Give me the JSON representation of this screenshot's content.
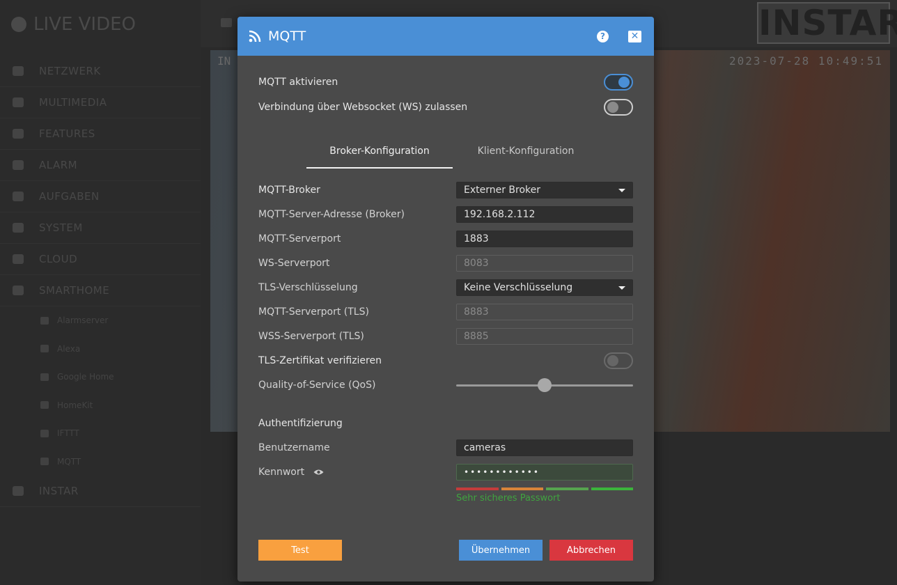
{
  "app": {
    "title": "LIVE VIDEO",
    "nav": [
      "NETZWERK",
      "MULTIMEDIA",
      "FEATURES",
      "ALARM",
      "AUFGABEN",
      "SYSTEM",
      "CLOUD",
      "SMARTHOME"
    ],
    "subnav": [
      "Alarmserver",
      "Alexa",
      "Google Home",
      "HomeKit",
      "IFTTT",
      "MQTT"
    ],
    "nav_last": "INSTAR",
    "logo": "INSTAR",
    "video_timestamp": "2023-07-28 10:49:51",
    "video_corner": "IN"
  },
  "modal": {
    "title": "MQTT",
    "toggles": {
      "mqtt_enable_label": "MQTT aktivieren",
      "mqtt_enable_on": true,
      "ws_label": "Verbindung über Websocket (WS) zulassen",
      "ws_on": false
    },
    "tabs": [
      "Broker-Konfiguration",
      "Klient-Konfiguration"
    ],
    "active_tab": 0,
    "fields": {
      "broker_label": "MQTT-Broker",
      "broker_value": "Externer Broker",
      "server_label": "MQTT-Server-Adresse (Broker)",
      "server_value": "192.168.2.112",
      "port_label": "MQTT-Serverport",
      "port_value": "1883",
      "ws_port_label": "WS-Serverport",
      "ws_port_value": "8083",
      "tls_label": "TLS-Verschlüsselung",
      "tls_value": "Keine Verschlüsselung",
      "port_tls_label": "MQTT-Serverport (TLS)",
      "port_tls_value": "8883",
      "wss_port_label": "WSS-Serverport (TLS)",
      "wss_port_value": "8885",
      "verify_label": "TLS-Zertifikat verifizieren",
      "verify_on": false,
      "qos_label": "Quality-of-Service (QoS)",
      "qos_value": 1,
      "qos_max": 2
    },
    "auth": {
      "section": "Authentifizierung",
      "user_label": "Benutzername",
      "user_value": "cameras",
      "pass_label": "Kennwort",
      "pass_value": "••••••••••••",
      "strength_text": "Sehr sicheres Passwort",
      "strength_colors": [
        "#c43c3c",
        "#d9843a",
        "#56a34f",
        "#3cb43c"
      ]
    },
    "buttons": {
      "test": "Test",
      "apply": "Übernehmen",
      "cancel": "Abbrechen"
    },
    "colors": {
      "header": "#4a8fd6",
      "test": "#f9a03f",
      "apply": "#4a8fd6",
      "cancel": "#d9373f"
    }
  }
}
